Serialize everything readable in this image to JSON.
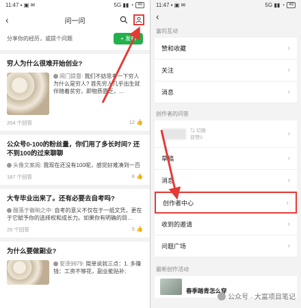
{
  "left": {
    "status": {
      "time": "11:47",
      "icons": "▪ ▣ ✉",
      "signal": "5G ▮▮ ◔",
      "battery": "49"
    },
    "title": "问一问",
    "share_prompt": "分享你的经历，或提个问题",
    "publish_label": "+ 发布",
    "questions": [
      {
        "title": "穷人为什么很难开始创业?",
        "author": "闹门提督:",
        "text": "我们不妨思考一下穷人为什么是穷人? 首先穷人几乎出生就伴随着贫穷，即物质匮乏，…",
        "answers": "204 个回答",
        "likes": "12"
      },
      {
        "title": "公众号0-100的粉丝量，你们用了多长时间? 还不到100的过来聊聊",
        "author": "头像文案阁:",
        "text": "我现在还没有100呢，感觉好难凑到一百",
        "answers": "187 个回答",
        "likes": "8"
      },
      {
        "title": "大专毕业出来了。还有必要去自考吗?",
        "author": "醋落于徽晌之中:",
        "text": "自考的意义不仅在于一纸文凭，更在于它赋予你的选择权和成长力。如果你有明确的目…",
        "answers": "25 个回答",
        "likes": "5"
      },
      {
        "title": "为什么要做副业?",
        "author": "安泽9979:",
        "text": "简单说就三点：1. 多赚钱：工资不够花，副业能贴补;"
      }
    ]
  },
  "right": {
    "status": {
      "time": "11:47",
      "icons": "▪ ▣ ✉",
      "signal": "5G ▮▮ ◔",
      "battery": "49"
    },
    "section_rich": "富的互动",
    "rows_a": [
      {
        "label": "赞和收藏"
      },
      {
        "label": "关注"
      },
      {
        "label": "消息"
      }
    ],
    "section_creator": "创作者的问答",
    "blur_switch": "⇆ 切换",
    "blur_sub": "获赞0",
    "rows_b": [
      {
        "label": "草稿"
      },
      {
        "label": "消息"
      }
    ],
    "highlight": "创作者中心",
    "rows_c": [
      {
        "label": "收到的邀请"
      },
      {
        "label": "问题广场"
      }
    ],
    "section_latest": "最新创作活动",
    "latest_title": "春季踏青怎么穿"
  },
  "watermark": "公众号 · 大富项目笔记",
  "colors": {
    "accent_green": "#22b14c",
    "annotation_red": "#e53935"
  }
}
